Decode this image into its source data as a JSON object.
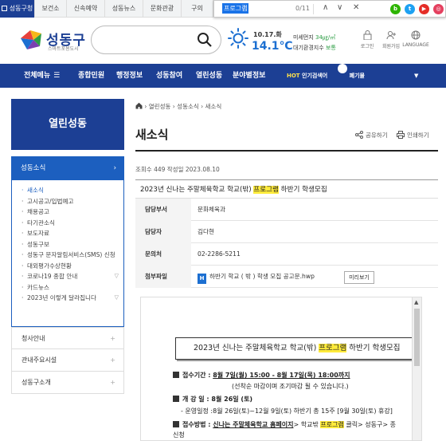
{
  "top_tabs": [
    "성동구청",
    "보건소",
    "신속예약",
    "성동뉴스",
    "문화관광",
    "구의"
  ],
  "find": {
    "query": "프로그램",
    "count": "0/11"
  },
  "social": [
    "b",
    "t",
    "▶",
    "f"
  ],
  "colors": {
    "brand": "#1c3f94",
    "accent": "#1c5fbf",
    "highlight": "#ffeb3b",
    "weather": "#1c6fd1",
    "good": "#2e9e45"
  },
  "header": {
    "logo_name": "성동구",
    "logo_slogan": "스마트포용도시",
    "weather": {
      "date": "10.17.화",
      "temp": "14.1℃"
    },
    "air_line1_label": "미세먼지 ",
    "air_line1_value": "34㎍/㎥",
    "air_line2_label": "대기환경지수 ",
    "air_line2_value": "보통",
    "util": [
      "로그인",
      "회원가입",
      "LANGUAGE"
    ]
  },
  "nav": {
    "all_menu": "전체메뉴",
    "items": [
      "종합민원",
      "행정정보",
      "성동참여",
      "열린성동",
      "분야별정보"
    ],
    "hot_label": "HOT",
    "hot_text": "인기검색어",
    "hot_rank": "1",
    "hot_keyword": "폐기물"
  },
  "sidebar": {
    "title": "열린성동",
    "section": "성동소식",
    "items": [
      {
        "label": "새소식",
        "active": true,
        "exp": ""
      },
      {
        "label": "고시공고/입법예고",
        "active": false,
        "exp": ""
      },
      {
        "label": "채용공고",
        "active": false,
        "exp": ""
      },
      {
        "label": "타기관소식",
        "active": false,
        "exp": ""
      },
      {
        "label": "보도자료",
        "active": false,
        "exp": ""
      },
      {
        "label": "성동구보",
        "active": false,
        "exp": ""
      },
      {
        "label": "성동구 문자알림서비스(SMS) 신청",
        "active": false,
        "exp": ""
      },
      {
        "label": "대외평가수상현황",
        "active": false,
        "exp": ""
      },
      {
        "label": "코로나19 종합 안내",
        "active": false,
        "exp": "▽"
      },
      {
        "label": "카드뉴스",
        "active": false,
        "exp": ""
      },
      {
        "label": "2023년 이렇게 달라집니다",
        "active": false,
        "exp": "▽"
      }
    ],
    "other": [
      "청사안내",
      "관내주요시설",
      "성동구소개"
    ]
  },
  "breadcrumb": [
    "열린성동",
    "성동소식",
    "새소식"
  ],
  "page_title": "새소식",
  "tools": {
    "share": "공유하기",
    "print": "인쇄하기"
  },
  "article": {
    "meta": "조회수 449 작성일 2023.08.10",
    "subject_before": "2023년 신나는 주말체육학교 학교(밖) ",
    "subject_hl": "프로그램",
    "subject_after": " 하반기 학생모집",
    "info": [
      {
        "k": "담당부서",
        "v": "문화체육과"
      },
      {
        "k": "담당자",
        "v": "김다현"
      },
      {
        "k": "문의처",
        "v": "02-2286-5211"
      }
    ],
    "attach_label": "첨부파일",
    "attach_name": "하반기 학교 ( 밖 ) 학생 모집 공고문.hwp",
    "preview": "미리보기"
  },
  "doc": {
    "title_before": "2023년 신나는 주말체육학교 학교(밖) ",
    "title_hl": "프로그램",
    "title_after": " 하반기 학생모집",
    "l1_label": "접수기간 : ",
    "l1_value": "8월 7일(월) 15:00 - 8월 17일(목) 18:00까지",
    "l2": "(선착순 마감이며 조기마감 될 수 있습니다.)",
    "l3_label": "개 강 일 : ",
    "l3_value": "8월 26일 (토)",
    "l4": "- 운영일정 :8월 26일(토)~12월 9일(토) 하반기 총 15주 [9월 30일(토) 휴강]",
    "l5_label": "접수방법 : ",
    "l5_link": "신나는 주말체육학교 홈페이지",
    "l5_mid": "> 학교밖 ",
    "l5_hl": "프로그램",
    "l5_after": " 클릭> 성동구> 종",
    "l6": "신청"
  }
}
